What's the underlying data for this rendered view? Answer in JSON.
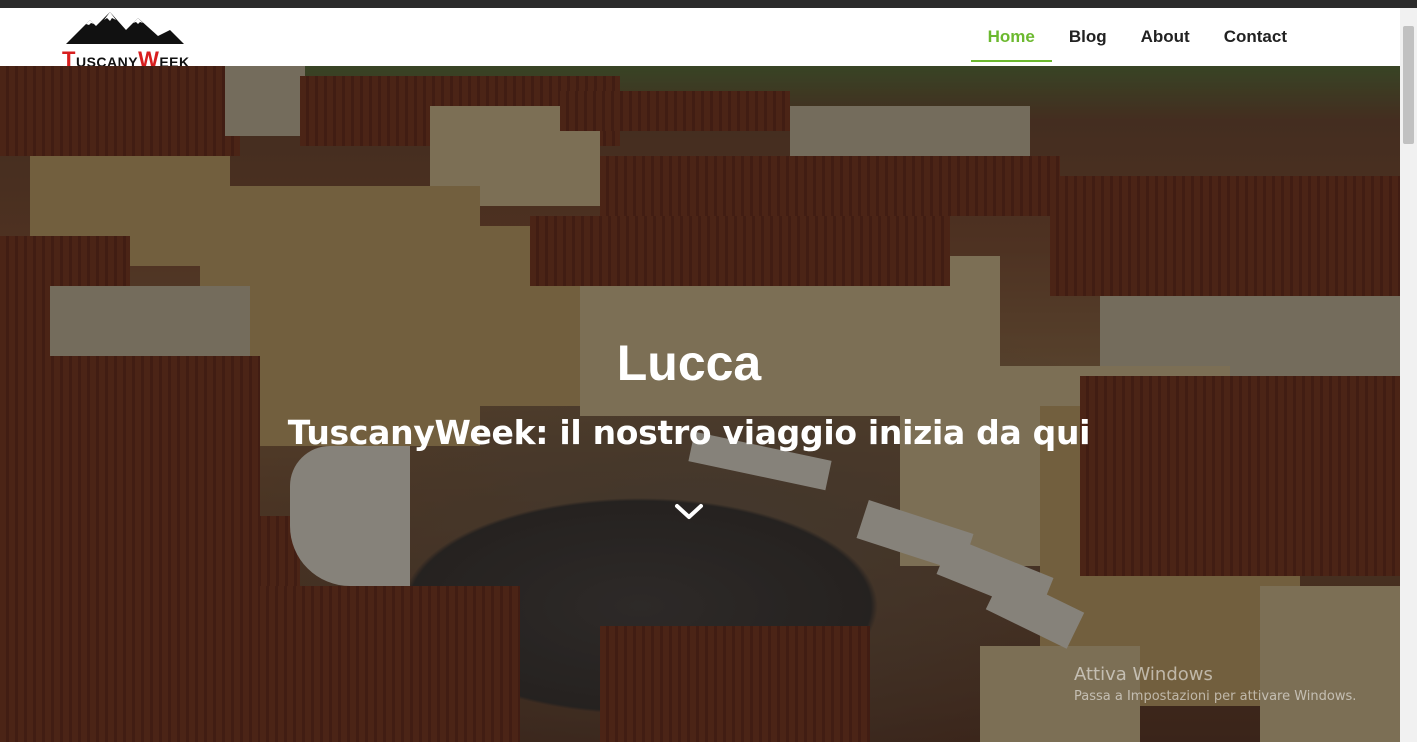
{
  "logo": {
    "first_letter": "T",
    "first_rest": "USCANY",
    "second_letter": "W",
    "second_rest": "EEK",
    "icon": "mountains-icon"
  },
  "nav": {
    "items": [
      {
        "label": "Home",
        "active": true
      },
      {
        "label": "Blog",
        "active": false
      },
      {
        "label": "About",
        "active": false
      },
      {
        "label": "Contact",
        "active": false
      }
    ]
  },
  "hero": {
    "title": "Lucca",
    "subtitle": "TuscanyWeek: il nostro viaggio inizia da qui",
    "scroll_icon": "chevron-down-icon"
  },
  "watermark": {
    "title": "Attiva Windows",
    "subtitle": "Passa a Impostazioni per attivare Windows."
  },
  "colors": {
    "accent": "#6cb92f",
    "logo_red": "#d81e1e"
  }
}
